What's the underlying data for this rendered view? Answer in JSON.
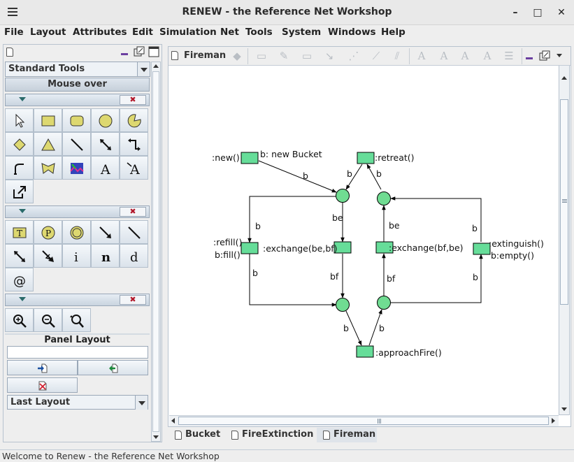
{
  "window": {
    "title": "RENEW - the Reference Net Workshop",
    "minimize_glyph": "–",
    "maximize_glyph": "□",
    "close_glyph": "✕"
  },
  "menubar": [
    "File",
    "Layout",
    "Attributes",
    "Edit",
    "Simulation",
    "Net",
    "Tools",
    "System",
    "Windows",
    "Help"
  ],
  "left_panel": {
    "palette_selector": "Standard Tools",
    "mouse_over_label": "Mouse over",
    "section_close_glyph": "✖",
    "tools_row1": [
      "selection-tool",
      "rectangle-tool",
      "round-rectangle-tool",
      "ellipse-tool",
      "pie-tool"
    ],
    "tools_row2": [
      "diamond-tool",
      "triangle-tool",
      "line-tool",
      "connection-tool",
      "elbow-connection-tool"
    ],
    "tools_row3": [
      "polyline-tool",
      "scribble-tool",
      "image-tool",
      "text-tool",
      "connected-text-tool"
    ],
    "tools_row4": [
      "link-tool"
    ],
    "net_tools_text": {
      "info": "i",
      "name": "n",
      "declaration": "d",
      "virtual_place": "@"
    },
    "panel_layout_label": "Panel Layout",
    "layout_selector": "Last Layout"
  },
  "document": {
    "title": "Fireman",
    "tabs": [
      "Bucket",
      "FireExtinction",
      "Fireman"
    ],
    "active_tab": "Fireman"
  },
  "net": {
    "transitions": [
      {
        "id": "new",
        "labels": [
          ":new()",
          "b: new Bucket"
        ]
      },
      {
        "id": "retreat",
        "labels": [
          ":retreat()"
        ]
      },
      {
        "id": "refill",
        "labels": [
          ":refill()",
          "b:fill()"
        ]
      },
      {
        "id": "exchange-be-bf",
        "labels": [
          ":exchange(be,bf)"
        ]
      },
      {
        "id": "exchange-bf-be",
        "labels": [
          ":exchange(bf,be)"
        ]
      },
      {
        "id": "extinguish",
        "labels": [
          ":extinguish()",
          "b:empty()"
        ]
      },
      {
        "id": "approach-fire",
        "labels": [
          ":approachFire()"
        ]
      }
    ],
    "arc_labels": {
      "new_to_place": "b",
      "place_to_retreat": "b",
      "retreat_to_place": "b",
      "place_to_refill": "b",
      "place_to_exchange_left": "be",
      "place_to_exchange_right": "be",
      "extinguish_to_place": "b",
      "refill_to_place": "b",
      "exchange_left_to_place": "bf",
      "place_to_exchange_right_bf": "bf",
      "place_to_extinguish": "b",
      "place_to_approach": "b",
      "approach_to_place": "b"
    },
    "colors": {
      "transition_fill": "#66dd99",
      "place_fill": "#70dc92",
      "outline": "#000000"
    }
  },
  "status_bar": "Welcome to Renew - the Reference Net Workshop"
}
